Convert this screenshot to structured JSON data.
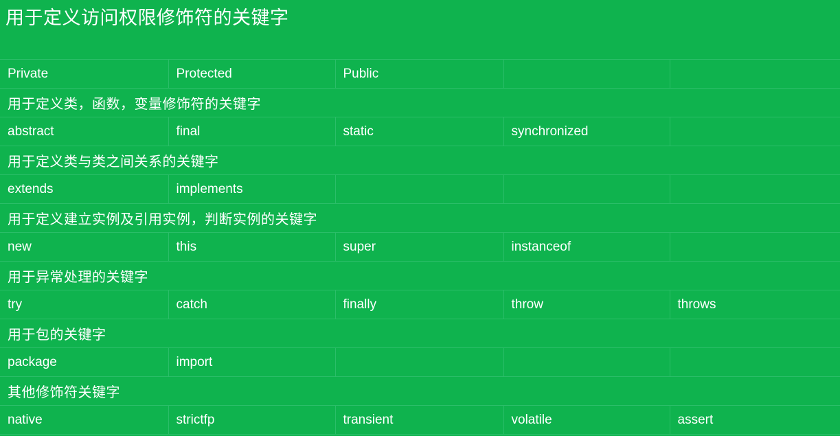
{
  "slide": {
    "title": "用于定义访问权限修饰符的关键字",
    "background_color": "#0FB34E",
    "text_color": "#FFFFFF",
    "grid_line_color": "#2BBE69"
  },
  "table": {
    "column_count": 5,
    "rows": [
      {
        "type": "data",
        "cells": [
          "Private",
          "Protected",
          "Public",
          "",
          ""
        ]
      },
      {
        "type": "section",
        "cells": [
          "用于定义类，函数，变量修饰符的关键字",
          "",
          "",
          "",
          ""
        ]
      },
      {
        "type": "data",
        "cells": [
          "abstract",
          "final",
          "static",
          "synchronized",
          ""
        ]
      },
      {
        "type": "section",
        "cells": [
          "用于定义类与类之间关系的关键字",
          "",
          "",
          "",
          ""
        ]
      },
      {
        "type": "data",
        "cells": [
          "extends",
          "implements",
          "",
          "",
          ""
        ]
      },
      {
        "type": "section",
        "cells": [
          "用于定义建立实例及引用实例，判断实例的关键字",
          "",
          "",
          "",
          ""
        ]
      },
      {
        "type": "data",
        "cells": [
          "new",
          "this",
          "super",
          "instanceof",
          ""
        ]
      },
      {
        "type": "section",
        "cells": [
          "用于异常处理的关键字",
          "",
          "",
          "",
          ""
        ]
      },
      {
        "type": "data",
        "cells": [
          "try",
          "catch",
          "finally",
          "throw",
          "throws"
        ]
      },
      {
        "type": "section",
        "cells": [
          "用于包的关键字",
          "",
          "",
          "",
          ""
        ]
      },
      {
        "type": "data",
        "cells": [
          "package",
          "import",
          "",
          "",
          ""
        ]
      },
      {
        "type": "section",
        "cells": [
          "其他修饰符关键字",
          "",
          "",
          "",
          ""
        ]
      },
      {
        "type": "data",
        "cells": [
          "native",
          "strictfp",
          "transient",
          "volatile",
          "assert"
        ]
      }
    ]
  }
}
